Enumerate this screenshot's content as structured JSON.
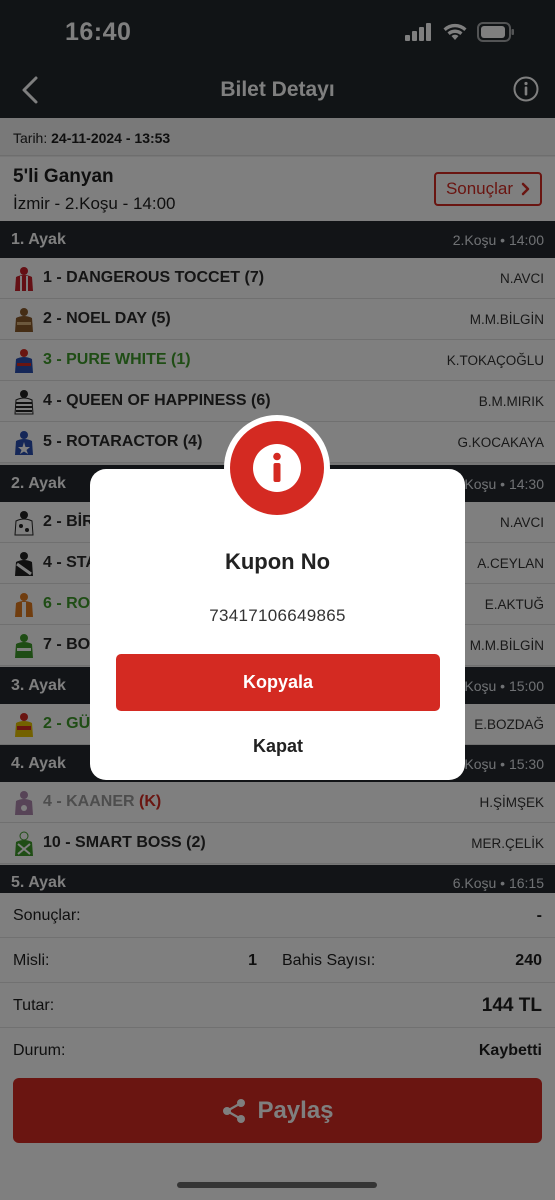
{
  "status": {
    "time": "16:40"
  },
  "nav": {
    "title": "Bilet Detayı"
  },
  "ticket": {
    "date_label": "Tarih:",
    "date_value": "24-11-2024 - 13:53",
    "bet_type": "5'li Ganyan",
    "race_info": "İzmir - 2.Koşu - 14:00",
    "results_button": "Sonuçlar"
  },
  "legs": [
    {
      "title": "1. Ayak",
      "time": "2.Koşu • 14:00",
      "horses": [
        {
          "name": "1 - DANGEROUS TOCCET (7)",
          "jockey": "N.AVCI",
          "style": "normal",
          "silk_colors": [
            "#c8202b",
            "#ffffff"
          ]
        },
        {
          "name": "2 - NOEL DAY (5)",
          "jockey": "M.M.BİLGİN",
          "style": "normal",
          "silk_colors": [
            "#8a5a2b",
            "#d9b07a"
          ]
        },
        {
          "name": "3 - PURE WHITE (1)",
          "jockey": "K.TOKAÇOĞLU",
          "style": "green",
          "silk_colors": [
            "#2a4fb0",
            "#d42a22"
          ]
        },
        {
          "name": "4 - QUEEN OF HAPPINESS (6)",
          "jockey": "B.M.MIRIK",
          "style": "normal",
          "silk_colors": [
            "#222222",
            "#ffffff"
          ]
        },
        {
          "name": "5 - ROTARACTOR (4)",
          "jockey": "G.KOCAKAYA",
          "style": "normal",
          "silk_colors": [
            "#2a4fb0",
            "#d42a22"
          ]
        }
      ]
    },
    {
      "title": "2. Ayak",
      "time": "3.Koşu • 14:30",
      "horses": [
        {
          "name": "2 - BİR",
          "jockey": "N.AVCI",
          "style": "normal",
          "silk_colors": [
            "#ffffff",
            "#222222"
          ]
        },
        {
          "name": "4 - STA",
          "jockey": "A.CEYLAN",
          "style": "normal",
          "silk_colors": [
            "#222222",
            "#ffffff"
          ]
        },
        {
          "name": "6 - RO",
          "jockey": "E.AKTUĞ",
          "style": "green",
          "silk_colors": [
            "#e07a1f",
            "#ffffff"
          ]
        },
        {
          "name": "7 - BO",
          "jockey": "M.M.BİLGİN",
          "style": "normal",
          "silk_colors": [
            "#3f9a2b",
            "#ffffff"
          ]
        }
      ]
    },
    {
      "title": "3. Ayak",
      "time": "4.Koşu • 15:00",
      "horses": [
        {
          "name": "2 - GÜ",
          "jockey": "E.BOZDAĞ",
          "style": "green",
          "silk_colors": [
            "#d42a22",
            "#e6c200"
          ]
        }
      ]
    },
    {
      "title": "4. Ayak",
      "time": "5.Koşu • 15:30",
      "horses": [
        {
          "name": "4 - KAANER",
          "suffix": "(K)",
          "jockey": "H.ŞİMŞEK",
          "style": "gray",
          "silk_colors": [
            "#7a3b7a",
            "#ffffff"
          ]
        },
        {
          "name": "10 - SMART BOSS (2)",
          "jockey": "MER.ÇELİK",
          "style": "normal",
          "silk_colors": [
            "#3f9a2b",
            "#ffffff"
          ]
        }
      ]
    },
    {
      "title": "5. Ayak",
      "time": "6.Koşu • 16:15",
      "horses": []
    }
  ],
  "summary": {
    "results_label": "Sonuçlar:",
    "results_value": "-",
    "misli_label": "Misli:",
    "misli_value": "1",
    "bet_count_label": "Bahis Sayısı:",
    "bet_count_value": "240",
    "amount_label": "Tutar:",
    "amount_value": "144 TL",
    "status_label": "Durum:",
    "status_value": "Kaybetti"
  },
  "share_button": "Paylaş",
  "modal": {
    "title": "Kupon No",
    "code": "73417106649865",
    "copy_button": "Kopyala",
    "close_button": "Kapat"
  },
  "colors": {
    "accent": "#d42a22",
    "header_dark": "#22282d",
    "winner_green": "#3f9a2b"
  }
}
